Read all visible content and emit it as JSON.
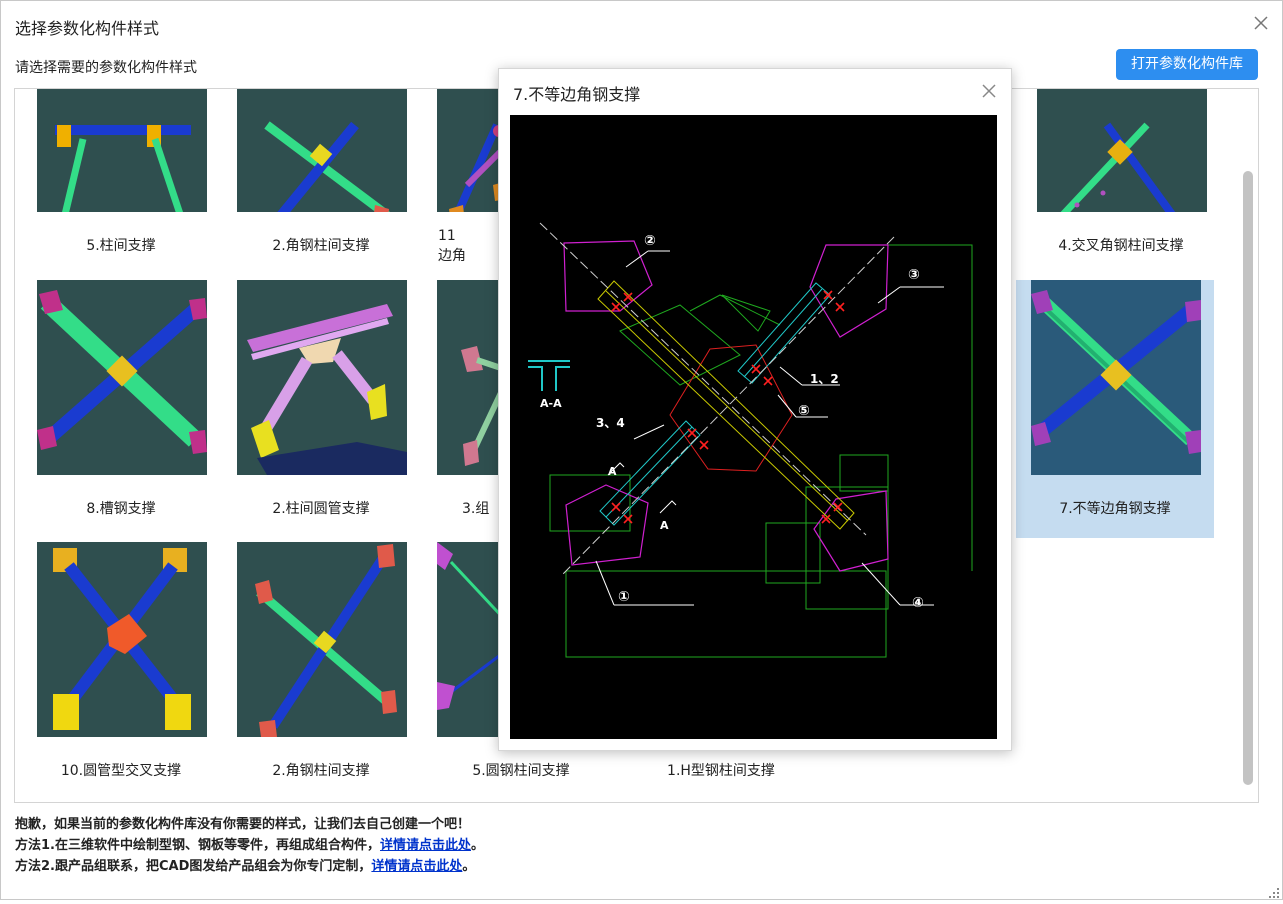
{
  "dialog": {
    "title": "选择参数化构件样式",
    "subtitle": "请选择需要的参数化构件样式",
    "open_library_label": "打开参数化构件库"
  },
  "grid": {
    "items": [
      {
        "label": "5.柱间支撑",
        "selected": false
      },
      {
        "label": "2.角钢柱间支撑",
        "selected": false
      },
      {
        "label": "11",
        "label2": "边角",
        "selected": false
      },
      {
        "label": "4.交叉角钢柱间支撑",
        "selected": false
      },
      {
        "label": "8.槽钢支撑",
        "selected": false
      },
      {
        "label": "2.柱间圆管支撑",
        "selected": false
      },
      {
        "label": "3.组",
        "selected": false
      },
      {
        "label": "7.不等边角钢支撑",
        "selected": true
      },
      {
        "label": "10.圆管型交叉支撑",
        "selected": false
      },
      {
        "label": "2.角钢柱间支撑",
        "selected": false
      },
      {
        "label": "5.圆钢柱间支撑",
        "selected": false
      },
      {
        "label": "1.H型钢柱间支撑",
        "selected": false
      }
    ]
  },
  "preview": {
    "title": "7.不等边角钢支撑",
    "cad_labels": {
      "n1": "①",
      "n2": "②",
      "n3": "③",
      "n4": "④",
      "n5": "⑤",
      "l12": "1、2",
      "l34": "3、4",
      "section": "A-A",
      "a_mark": "A"
    }
  },
  "footer": {
    "line1": "抱歉，如果当前的参数化构件库没有你需要的样式，让我们去自己创建一个吧！",
    "line2_prefix": "方法1.在三维软件中绘制型钢、钢板等零件，再组成组合构件，",
    "line2_link": "详情请点击此处",
    "line2_suffix": "。",
    "line3_prefix": "方法2.跟产品组联系，把CAD图发给产品组会为你专门定制，",
    "line3_link": "详情请点击此处",
    "line3_suffix": "。"
  },
  "colors": {
    "accent": "#2d8ef0",
    "thumb_bg": "#2f4f4f",
    "selected_bg": "#c5dcf0",
    "link": "#0033cc",
    "cad_bg": "#000000"
  }
}
